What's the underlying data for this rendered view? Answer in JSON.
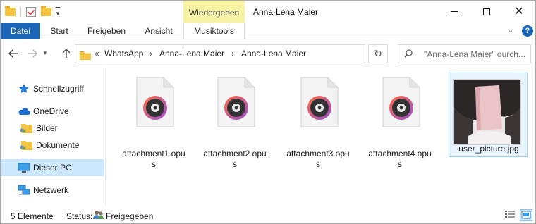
{
  "window": {
    "title": "Anna-Lena Maier",
    "contextual_tab_header": "Wiedergeben"
  },
  "ribbon": {
    "tabs": [
      {
        "label": "Datei",
        "active": true
      },
      {
        "label": "Start"
      },
      {
        "label": "Freigeben"
      },
      {
        "label": "Ansicht"
      },
      {
        "label": "Musiktools"
      }
    ],
    "help": "?"
  },
  "address": {
    "overflow": "«",
    "crumbs": [
      "WhatsApp",
      "Anna-Lena Maier",
      "Anna-Lena Maier"
    ],
    "separator": "›"
  },
  "search": {
    "placeholder": "\"Anna-Lena Maier\" durch..."
  },
  "navigation": {
    "items": [
      {
        "label": "Schnellzugriff",
        "icon": "star-icon"
      },
      {
        "label": "OneDrive",
        "icon": "cloud-icon"
      },
      {
        "label": "Bilder",
        "icon": "folder-icon"
      },
      {
        "label": "Dokumente",
        "icon": "folder-icon"
      },
      {
        "label": "Dieser PC",
        "icon": "pc-icon",
        "selected": true
      },
      {
        "label": "Netzwerk",
        "icon": "network-icon"
      }
    ]
  },
  "files": [
    {
      "name_line1": "attachment1.opu",
      "name_line2": "s",
      "type": "audio"
    },
    {
      "name_line1": "attachment2.opu",
      "name_line2": "s",
      "type": "audio"
    },
    {
      "name_line1": "attachment3.opu",
      "name_line2": "s",
      "type": "audio"
    },
    {
      "name_line1": "attachment4.opu",
      "name_line2": "s",
      "type": "audio"
    },
    {
      "name_line1": "user_picture.jpg",
      "name_line2": "",
      "type": "image",
      "selected": true
    }
  ],
  "status": {
    "count": "5 Elemente",
    "label": "Status:",
    "share": "Freigegeben"
  },
  "colors": {
    "accent": "#1a65b6",
    "contextual": "#f9f3a4",
    "selection": "#cce8ff",
    "folder": "#f5c542"
  }
}
